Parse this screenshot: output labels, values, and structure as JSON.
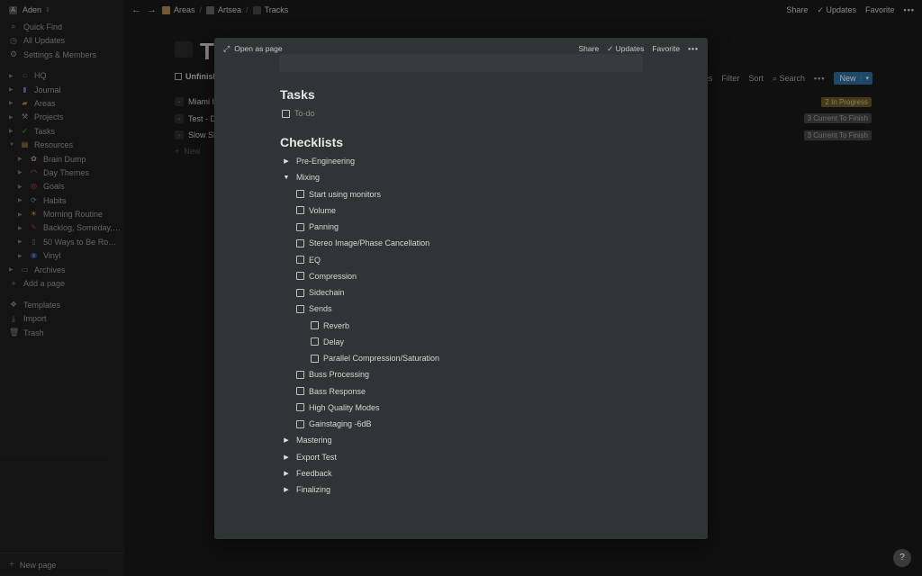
{
  "sidebar": {
    "workspace": "Aden",
    "nav": [
      {
        "label": "Quick Find",
        "icon": "search-icon",
        "glyph": "⌕"
      },
      {
        "label": "All Updates",
        "icon": "clock-icon",
        "glyph": "◷"
      },
      {
        "label": "Settings & Members",
        "icon": "gear-icon",
        "glyph": "⚙"
      }
    ],
    "tree": [
      {
        "label": "HQ",
        "icon": "house-icon",
        "glyph": "⌂",
        "color": "#4a90d9",
        "child": false,
        "open": false
      },
      {
        "label": "Journal",
        "icon": "book-icon",
        "glyph": "▮",
        "color": "#5b7fb0",
        "child": false,
        "open": false
      },
      {
        "label": "Areas",
        "icon": "folder-icon",
        "glyph": "▰",
        "color": "#b08850",
        "child": false,
        "open": false
      },
      {
        "label": "Projects",
        "icon": "tools-icon",
        "glyph": "⚒",
        "color": "#999",
        "child": false,
        "open": false
      },
      {
        "label": "Tasks",
        "icon": "check-box-icon",
        "glyph": "✓",
        "color": "#4caf50",
        "child": false,
        "open": false
      },
      {
        "label": "Resources",
        "icon": "books-icon",
        "glyph": "▤",
        "color": "#c9a24a",
        "child": false,
        "open": true
      },
      {
        "label": "Brain Dump",
        "icon": "brain-icon",
        "glyph": "✿",
        "color": "#d48fa0",
        "child": true,
        "open": false
      },
      {
        "label": "Day Themes",
        "icon": "rainbow-icon",
        "glyph": "◠",
        "color": "#e0804a",
        "child": true,
        "open": false
      },
      {
        "label": "Goals",
        "icon": "target-icon",
        "glyph": "◎",
        "color": "#d04040",
        "child": true,
        "open": false
      },
      {
        "label": "Habits",
        "icon": "repeat-icon",
        "glyph": "⟳",
        "color": "#6a8fc4",
        "child": true,
        "open": false
      },
      {
        "label": "Morning Routine",
        "icon": "sunrise-icon",
        "glyph": "☀",
        "color": "#e09a40",
        "child": true,
        "open": false
      },
      {
        "label": "Backlog, Someday, M...",
        "icon": "pin-icon",
        "glyph": "✎",
        "color": "#c03030",
        "child": true,
        "open": false
      },
      {
        "label": "50 Ways to Be Roman...",
        "icon": "document-icon",
        "glyph": "▯",
        "color": "#888",
        "child": true,
        "open": false
      },
      {
        "label": "Vinyl",
        "icon": "disc-icon",
        "glyph": "◉",
        "color": "#4a7fd0",
        "child": true,
        "open": false
      },
      {
        "label": "Archives",
        "icon": "archive-icon",
        "glyph": "▭",
        "color": "#a0855a",
        "child": false,
        "open": false
      }
    ],
    "add_page": "Add a page",
    "bottom_nav": [
      {
        "label": "Templates",
        "icon": "templates-icon",
        "glyph": "❖"
      },
      {
        "label": "Import",
        "icon": "download-icon",
        "glyph": "⤓"
      },
      {
        "label": "Trash",
        "icon": "trash-icon",
        "glyph": "🗑"
      }
    ],
    "new_page": "New page"
  },
  "topbar": {
    "breadcrumbs": [
      {
        "label": "Areas",
        "color": "#b08850"
      },
      {
        "label": "Artsea",
        "color": "#666"
      },
      {
        "label": "Tracks",
        "color": "#444"
      }
    ],
    "share": "Share",
    "updates": "Updates",
    "favorite": "Favorite"
  },
  "bg_page": {
    "title": "T",
    "view_tab": "Unfinish",
    "toolbar": {
      "properties": "perties",
      "filter": "Filter",
      "sort": "Sort",
      "search": "Search",
      "new": "New"
    },
    "rows": [
      {
        "label": "Miami I",
        "tag": "2 In Progress",
        "tag_bg": "#6b5a2a",
        "tag_fg": "#d8c07a"
      },
      {
        "label": "Test - D",
        "tag": "3 Current To Finish",
        "tag_bg": "#454545",
        "tag_fg": "#a8a8a8"
      },
      {
        "label": "Slow Sl",
        "tag": "3 Current To Finish",
        "tag_bg": "#454545",
        "tag_fg": "#a8a8a8"
      }
    ],
    "new_row": "New"
  },
  "modal": {
    "open_as_page": "Open as page",
    "share": "Share",
    "updates": "Updates",
    "favorite": "Favorite",
    "tasks_heading": "Tasks",
    "todo_placeholder": "To-do",
    "checklists_heading": "Checklists",
    "items": [
      {
        "type": "toggle",
        "label": "Pre-Engineering",
        "level": 0,
        "open": false
      },
      {
        "type": "toggle",
        "label": "Mixing",
        "level": 0,
        "open": true
      },
      {
        "type": "check",
        "label": "Start using monitors",
        "level": 1
      },
      {
        "type": "check",
        "label": "Volume",
        "level": 1
      },
      {
        "type": "check",
        "label": "Panning",
        "level": 1
      },
      {
        "type": "check",
        "label": "Stereo Image/Phase Cancellation",
        "level": 1
      },
      {
        "type": "check",
        "label": "EQ",
        "level": 1
      },
      {
        "type": "check",
        "label": "Compression",
        "level": 1
      },
      {
        "type": "check",
        "label": "Sidechain",
        "level": 1
      },
      {
        "type": "check",
        "label": "Sends",
        "level": 1
      },
      {
        "type": "check",
        "label": "Reverb",
        "level": 2
      },
      {
        "type": "check",
        "label": "Delay",
        "level": 2
      },
      {
        "type": "check",
        "label": "Parallel Compression/Saturation",
        "level": 2
      },
      {
        "type": "check",
        "label": "Buss Processing",
        "level": 1
      },
      {
        "type": "check",
        "label": "Bass Response",
        "level": 1
      },
      {
        "type": "check",
        "label": "High Quality Modes",
        "level": 1
      },
      {
        "type": "check",
        "label": "Gainstaging -6dB",
        "level": 1
      },
      {
        "type": "toggle",
        "label": "Mastering",
        "level": 0,
        "open": false
      },
      {
        "type": "toggle",
        "label": "Export Test",
        "level": 0,
        "open": false
      },
      {
        "type": "toggle",
        "label": "Feedback",
        "level": 0,
        "open": false
      },
      {
        "type": "toggle",
        "label": "Finalizing",
        "level": 0,
        "open": false
      }
    ]
  },
  "help": "?"
}
